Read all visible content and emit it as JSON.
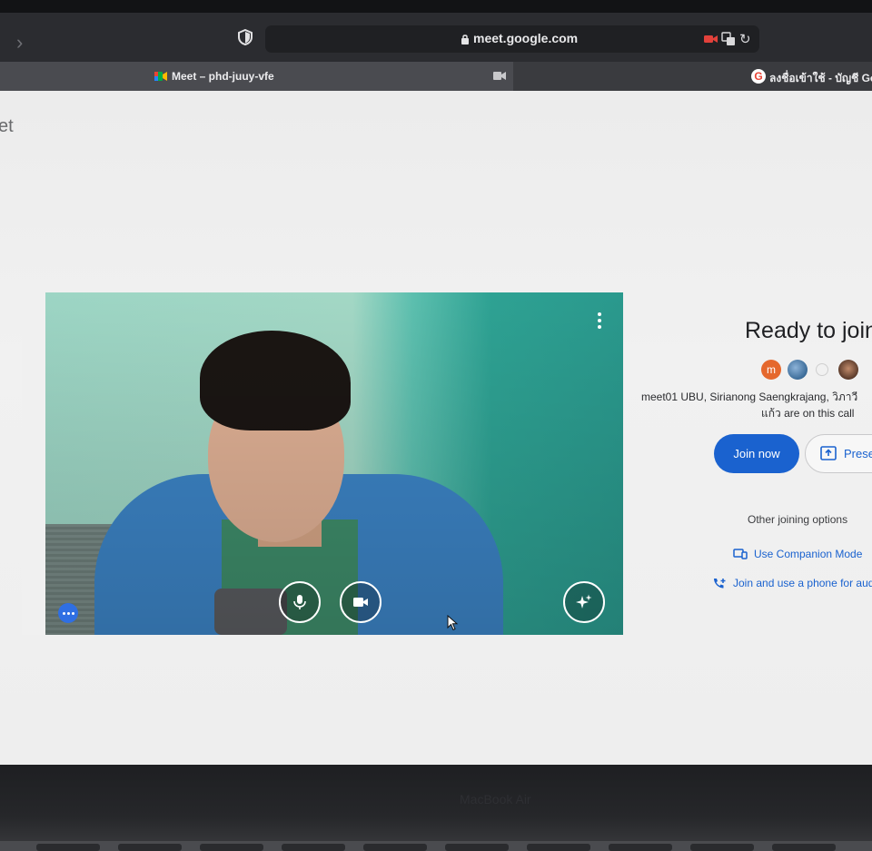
{
  "browser": {
    "url": "meet.google.com",
    "tabs": [
      {
        "label": "Meet – phd-juuy-vfe"
      },
      {
        "label": "ลงชื่อเข้าใช้ - บัญชี Googl"
      }
    ]
  },
  "page": {
    "logo_fragment": "et",
    "ready_title": "Ready to join",
    "avatar_initial": "m",
    "participants_line1": "meet01 UBU, Sirianong Saengkrajang, วิภาวี",
    "participants_line2": "แก้ว are on this call",
    "join_now_label": "Join now",
    "present_label": "Present",
    "other_options_label": "Other joining options",
    "companion_mode_label": "Use Companion Mode",
    "phone_audio_label": "Join and use a phone for audio"
  },
  "bezel": {
    "brand": "MacBook Air"
  },
  "colors": {
    "accent": "#1a62cf",
    "avatar_m": "#e5682d",
    "mic_on": "#ffffff"
  }
}
